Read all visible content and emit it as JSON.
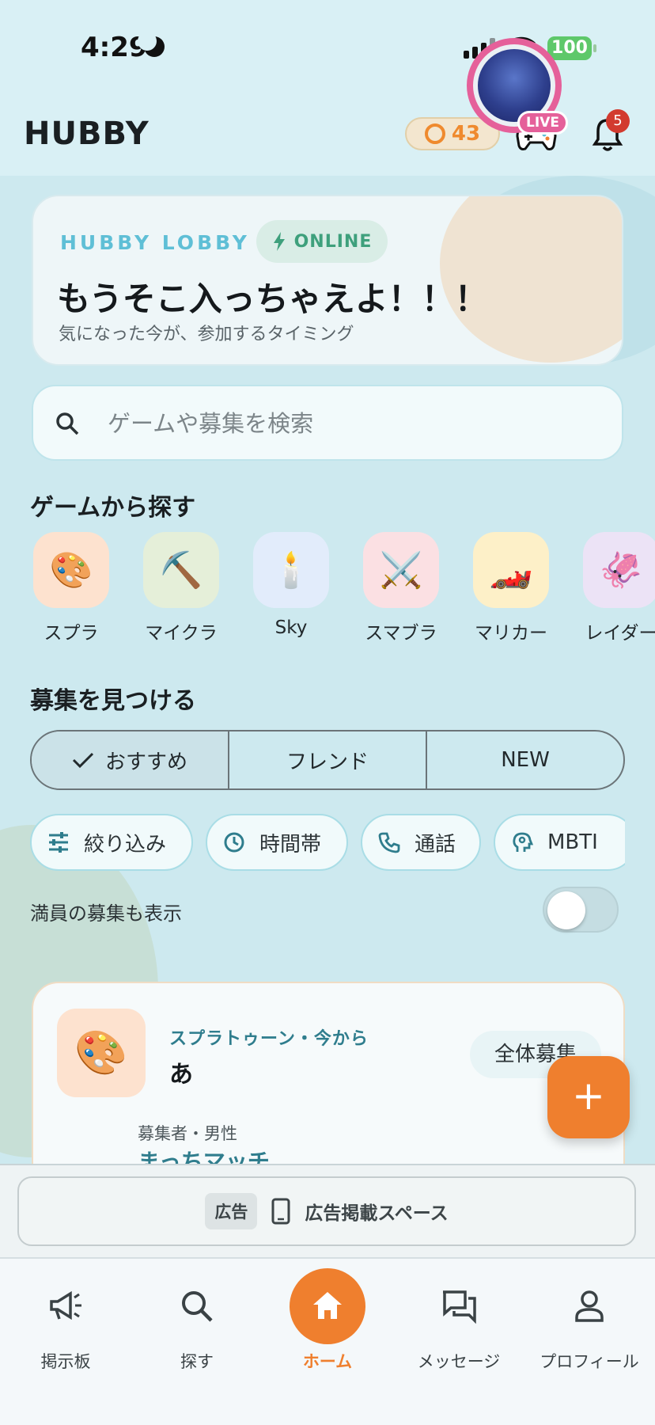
{
  "status_bar": {
    "time": "4:29",
    "battery": "100"
  },
  "header": {
    "title": "HUBBY",
    "coins": "43",
    "notification_count": "5"
  },
  "lobby": {
    "label": "HUBBY LOBBY",
    "status": "ONLINE",
    "headline": "もうそこ入っちゃえよ！！！",
    "subtitle": "気になった今が、参加するタイミング",
    "live_tag": "LIVE"
  },
  "search": {
    "placeholder": "ゲームや募集を検索"
  },
  "games_section": {
    "title": "ゲームから探す",
    "items": [
      {
        "label": "スプラ",
        "icon": "🎨",
        "color": "#fde2cf"
      },
      {
        "label": "マイクラ",
        "icon": "⛏️",
        "color": "#e5efd9"
      },
      {
        "label": "Sky",
        "icon": "🕯️",
        "color": "#e2ecfb"
      },
      {
        "label": "スマブラ",
        "icon": "⚔️",
        "color": "#fbe0e3"
      },
      {
        "label": "マリカー",
        "icon": "🏎️",
        "color": "#fdf0c8"
      },
      {
        "label": "レイダー",
        "icon": "🦑",
        "color": "#ece3f6"
      }
    ]
  },
  "recruit_section": {
    "title": "募集を見つける",
    "tabs": [
      "おすすめ",
      "フレンド",
      "NEW"
    ],
    "filters": [
      "絞り込み",
      "時間帯",
      "通話",
      "MBTI"
    ],
    "show_full_label": "満員の募集も表示"
  },
  "post": {
    "meta": "スプラトゥーン・今から",
    "title": "あ",
    "tag": "全体募集",
    "host_label": "募集者・男性",
    "host_name": "まっちマッチ",
    "thumb_icon": "🎨"
  },
  "fab": {
    "label": "+"
  },
  "ad": {
    "badge": "広告",
    "text": "広告掲載スペース"
  },
  "bottom_nav": {
    "items": [
      "掲示板",
      "探す",
      "ホーム",
      "メッセージ",
      "プロフィール"
    ]
  },
  "colors": {
    "accent": "#ef7f2e",
    "teal": "#5fbfd6",
    "live": "#e5609a"
  }
}
